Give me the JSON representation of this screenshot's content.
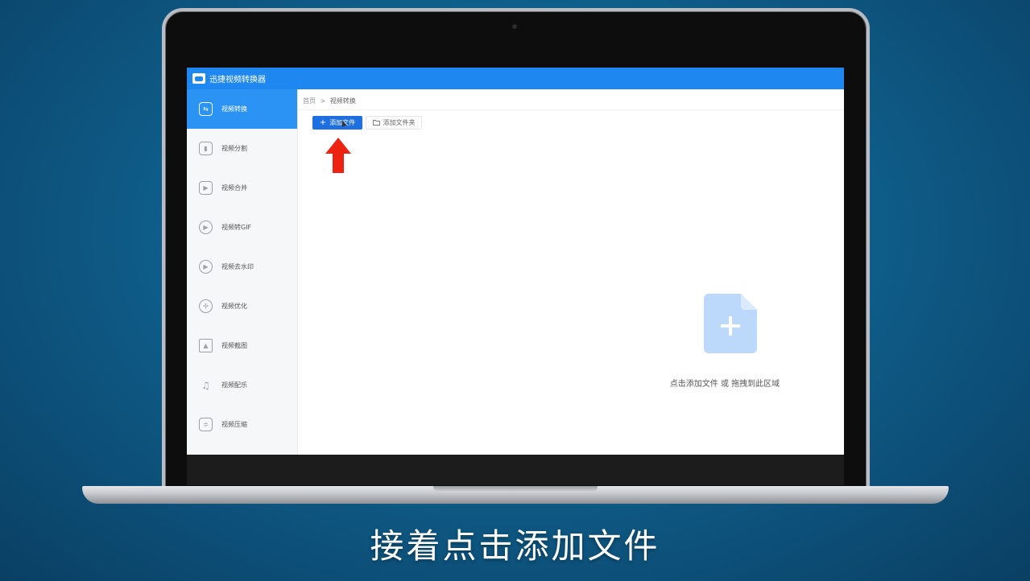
{
  "app": {
    "title": "迅捷视频转换器"
  },
  "sidebar": {
    "items": [
      {
        "label": "视频转换",
        "icon": "convert-icon",
        "active": true
      },
      {
        "label": "视频分割",
        "icon": "split-icon",
        "active": false
      },
      {
        "label": "视频合并",
        "icon": "merge-icon",
        "active": false
      },
      {
        "label": "视频转GIF",
        "icon": "gif-icon",
        "active": false
      },
      {
        "label": "视频去水印",
        "icon": "watermark-icon",
        "active": false
      },
      {
        "label": "视频优化",
        "icon": "optimize-icon",
        "active": false
      },
      {
        "label": "视频截图",
        "icon": "screenshot-icon",
        "active": false
      },
      {
        "label": "视频配乐",
        "icon": "music-icon",
        "active": false
      },
      {
        "label": "视频压缩",
        "icon": "compress-icon",
        "active": false
      }
    ]
  },
  "breadcrumb": {
    "home": "首页",
    "separator": ">",
    "current": "视频转换"
  },
  "toolbar": {
    "add_file_label": "添加文件",
    "add_file_symbol": "+",
    "add_folder_label": "添加文件夹"
  },
  "drop_zone": {
    "hint": "点击添加文件 或 拖拽到此区域"
  },
  "caption": {
    "text": "接着点击添加文件"
  },
  "colors": {
    "titlebar": "#1e88f0",
    "active_sidebar": "#2a93f3",
    "primary_button": "#1e6fe0",
    "annotation_arrow": "#ee2211",
    "drop_icon": "#bcd8fb"
  }
}
